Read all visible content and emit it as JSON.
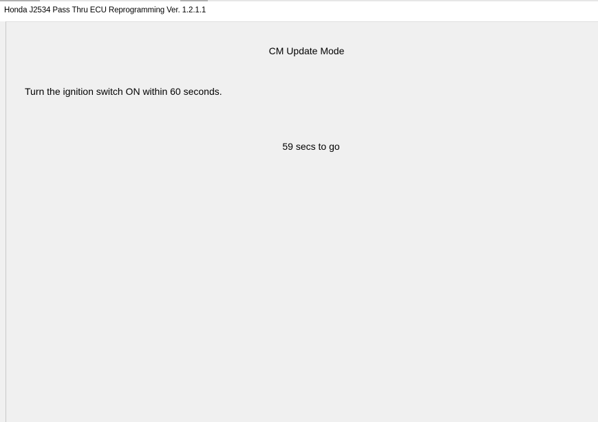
{
  "window": {
    "title": "Honda J2534 Pass Thru ECU Reprogramming Ver. 1.2.1.1"
  },
  "main": {
    "mode_title": "CM Update Mode",
    "instruction": "Turn the ignition switch ON within 60 seconds.",
    "countdown": "59 secs to go"
  },
  "colors": {
    "window_background": "#f0f0f0",
    "titlebar_background": "#ffffff",
    "text": "#000000"
  }
}
